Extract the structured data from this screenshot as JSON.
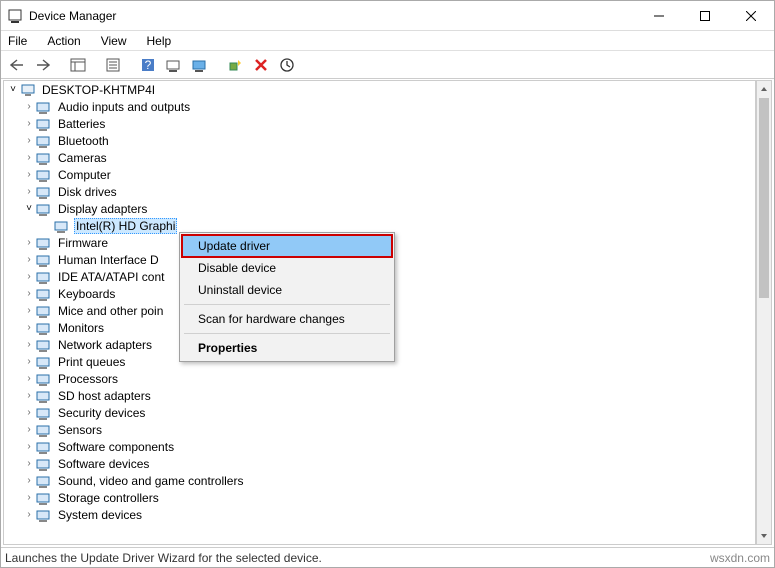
{
  "window": {
    "title": "Device Manager"
  },
  "menubar": [
    "File",
    "Action",
    "View",
    "Help"
  ],
  "root": "DESKTOP-KHTMP4I",
  "categories": [
    {
      "label": "Audio inputs and outputs",
      "expanded": false
    },
    {
      "label": "Batteries",
      "expanded": false
    },
    {
      "label": "Bluetooth",
      "expanded": false
    },
    {
      "label": "Cameras",
      "expanded": false
    },
    {
      "label": "Computer",
      "expanded": false
    },
    {
      "label": "Disk drives",
      "expanded": false
    },
    {
      "label": "Display adapters",
      "expanded": true,
      "children": [
        {
          "label": "Intel(R) HD Graphi",
          "selected": true
        }
      ]
    },
    {
      "label": "Firmware",
      "expanded": false
    },
    {
      "label": "Human Interface D",
      "expanded": false
    },
    {
      "label": "IDE ATA/ATAPI cont",
      "expanded": false
    },
    {
      "label": "Keyboards",
      "expanded": false
    },
    {
      "label": "Mice and other poin",
      "expanded": false
    },
    {
      "label": "Monitors",
      "expanded": false
    },
    {
      "label": "Network adapters",
      "expanded": false
    },
    {
      "label": "Print queues",
      "expanded": false
    },
    {
      "label": "Processors",
      "expanded": false
    },
    {
      "label": "SD host adapters",
      "expanded": false
    },
    {
      "label": "Security devices",
      "expanded": false
    },
    {
      "label": "Sensors",
      "expanded": false
    },
    {
      "label": "Software components",
      "expanded": false
    },
    {
      "label": "Software devices",
      "expanded": false
    },
    {
      "label": "Sound, video and game controllers",
      "expanded": false
    },
    {
      "label": "Storage controllers",
      "expanded": false
    },
    {
      "label": "System devices",
      "expanded": false
    }
  ],
  "context_menu": {
    "items": [
      {
        "label": "Update driver",
        "highlighted": true
      },
      {
        "label": "Disable device"
      },
      {
        "label": "Uninstall device"
      },
      {
        "sep": true
      },
      {
        "label": "Scan for hardware changes"
      },
      {
        "sep": true
      },
      {
        "label": "Properties",
        "bold": true
      }
    ]
  },
  "statusbar": {
    "text": "Launches the Update Driver Wizard for the selected device.",
    "watermark": "wsxdn.com"
  }
}
